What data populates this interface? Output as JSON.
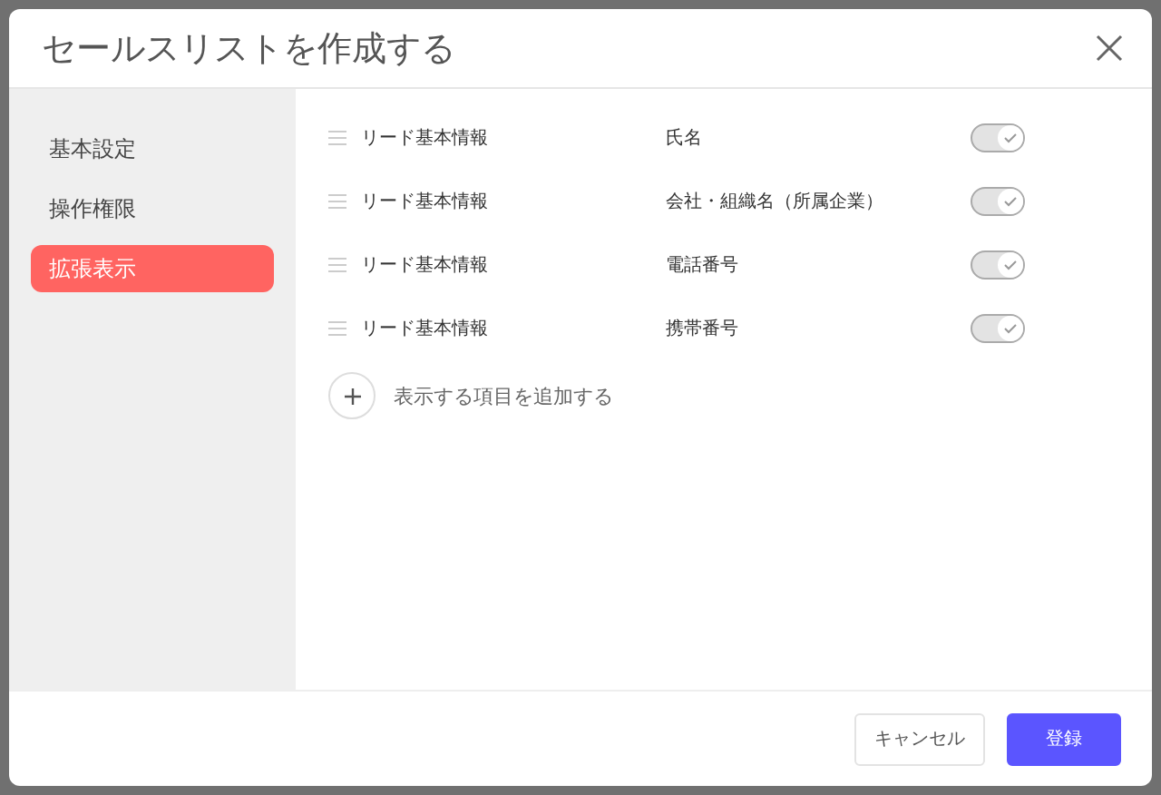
{
  "dialog": {
    "title": "セールスリストを作成する"
  },
  "sidebar": {
    "items": [
      {
        "label": "基本設定",
        "selected": false
      },
      {
        "label": "操作権限",
        "selected": false
      },
      {
        "label": "拡張表示",
        "selected": true
      }
    ]
  },
  "fields": [
    {
      "category": "リード基本情報",
      "name": "氏名",
      "on": true
    },
    {
      "category": "リード基本情報",
      "name": "会社・組織名（所属企業）",
      "on": true
    },
    {
      "category": "リード基本情報",
      "name": "電話番号",
      "on": true
    },
    {
      "category": "リード基本情報",
      "name": "携帯番号",
      "on": true
    }
  ],
  "add_item": {
    "label": "表示する項目を追加する"
  },
  "footer": {
    "cancel": "キャンセル",
    "submit": "登録"
  }
}
